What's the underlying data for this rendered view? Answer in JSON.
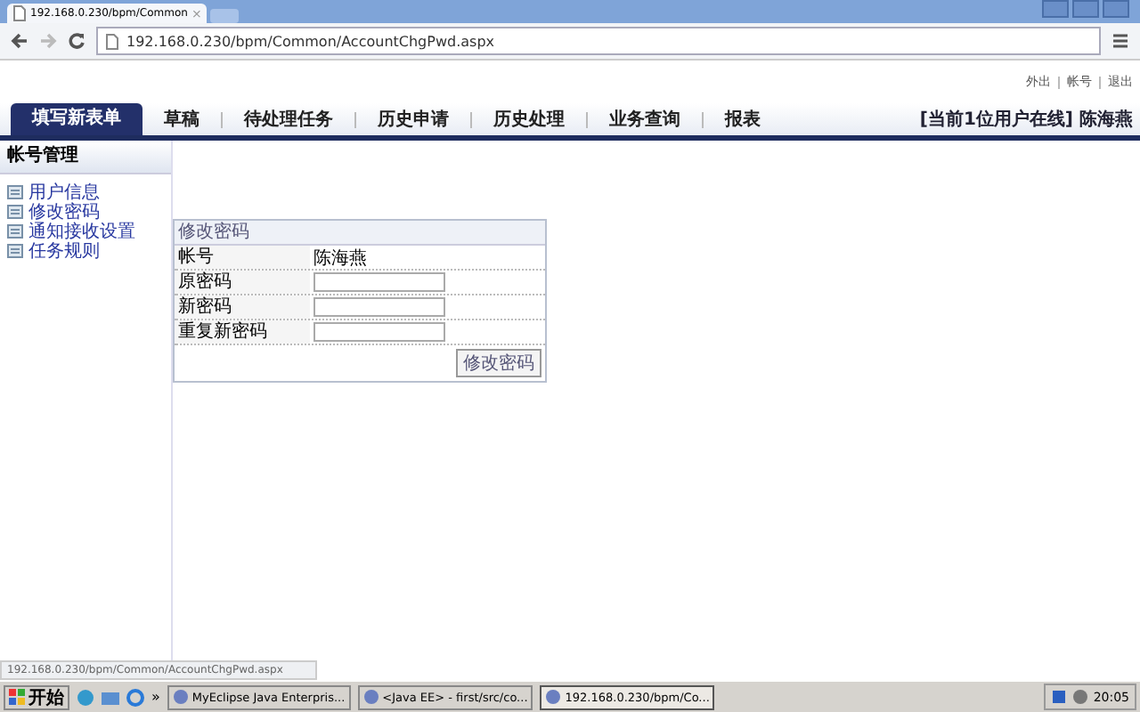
{
  "browser": {
    "tab_title": "192.168.0.230/bpm/Common",
    "tab_close": "×",
    "url": "192.168.0.230/bpm/Common/AccountChgPwd.aspx"
  },
  "top_links": [
    "外出",
    "帐号",
    "退出"
  ],
  "nav": {
    "tabs": [
      {
        "label": "填写新表单",
        "selected": true
      },
      {
        "label": "草稿",
        "selected": false
      },
      {
        "label": "待处理任务",
        "selected": false
      },
      {
        "label": "历史申请",
        "selected": false
      },
      {
        "label": "历史处理",
        "selected": false
      },
      {
        "label": "业务查询",
        "selected": false
      },
      {
        "label": "报表",
        "selected": false
      }
    ],
    "user_status": "[当前1位用户在线] 陈海燕"
  },
  "sidebar": {
    "title": "帐号管理",
    "items": [
      {
        "label": "用户信息"
      },
      {
        "label": "修改密码"
      },
      {
        "label": "通知接收设置"
      },
      {
        "label": "任务规则"
      }
    ]
  },
  "form": {
    "title": "修改密码",
    "rows": [
      {
        "kind": "text",
        "label": "帐号",
        "value": "陈海燕"
      },
      {
        "kind": "password",
        "label": "原密码"
      },
      {
        "kind": "password",
        "label": "新密码"
      },
      {
        "kind": "password",
        "label": "重复新密码"
      }
    ],
    "submit": "修改密码"
  },
  "status_url": "192.168.0.230/bpm/Common/AccountChgPwd.aspx",
  "taskbar": {
    "start": "开始",
    "more": "»",
    "tasks": [
      {
        "label": "MyEclipse Java Enterpris...",
        "selected": false
      },
      {
        "label": "<Java EE> - first/src/co...",
        "selected": false
      },
      {
        "label": "192.168.0.230/bpm/Co...",
        "selected": true
      }
    ],
    "time": "20:05"
  }
}
